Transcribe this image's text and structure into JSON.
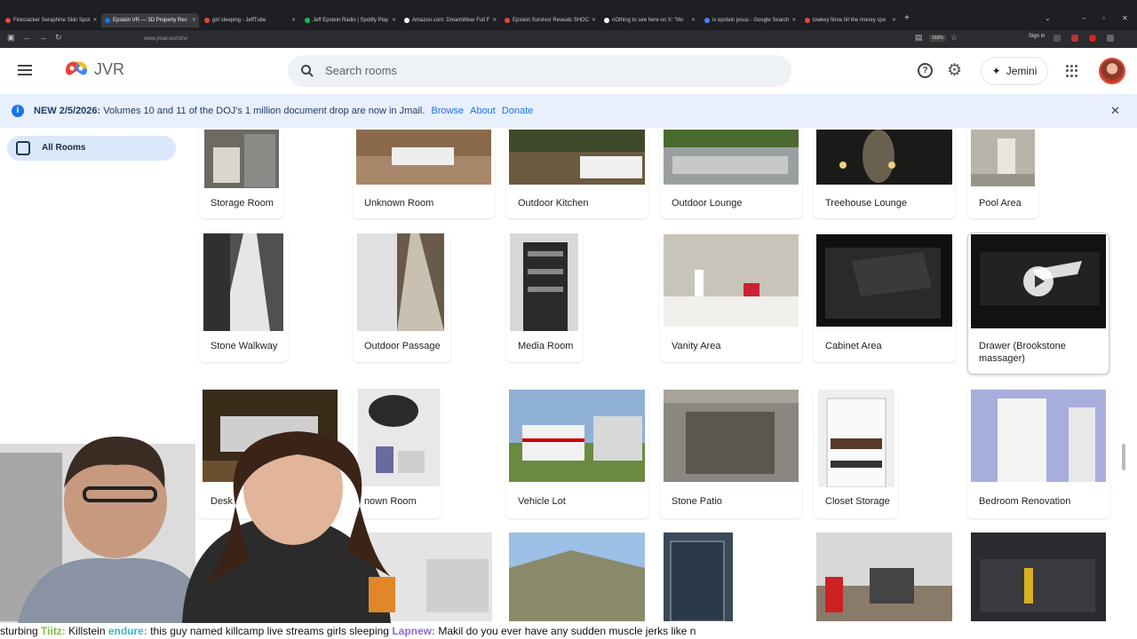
{
  "browser": {
    "tabs": [
      {
        "title": "Firecracker Seraphine Skin Spot",
        "color": "#e04b3b"
      },
      {
        "title": "Epstein VR — 3D Property Rec",
        "color": "#1a73e8"
      },
      {
        "title": "girl sleeping - JeffTube",
        "color": "#e04b3b"
      },
      {
        "title": "Jeff Epstein Radio | Spotify Play",
        "color": "#1db954"
      },
      {
        "title": "Amazon.com: DreamWear Full F",
        "color": "#ffffff"
      },
      {
        "title": "Epstein Survivor Reveals SHOC",
        "color": "#e04b3b"
      },
      {
        "title": "nOthing to see here on X: \"Mo",
        "color": "#ffffff"
      },
      {
        "title": "is epstein jesus - Google Search",
        "color": "#4285f4"
      },
      {
        "title": "lowkey finna hit the money spo",
        "color": "#e04b3b"
      }
    ],
    "url": "www.jmail.world/vr",
    "zoom": "160%",
    "signin": "Sign in"
  },
  "header": {
    "app_name": "JVR",
    "search_placeholder": "Search rooms",
    "assistant_label": "Jemini"
  },
  "banner": {
    "prefix": "NEW 2/5/2026:",
    "message": "Volumes 10 and 11 of the DOJ's 1 million document drop are now in Jmail.",
    "links": [
      "Browse",
      "About",
      "Donate"
    ]
  },
  "sidebar": {
    "items": [
      {
        "label": "All Rooms"
      }
    ]
  },
  "rooms": [
    {
      "label": "Storage Room"
    },
    {
      "label": "Unknown Room"
    },
    {
      "label": "Outdoor Kitchen"
    },
    {
      "label": "Outdoor Lounge"
    },
    {
      "label": "Treehouse Lounge"
    },
    {
      "label": "Pool Area"
    },
    {
      "label": "Stone Walkway"
    },
    {
      "label": "Outdoor Passage"
    },
    {
      "label": "Media Room"
    },
    {
      "label": "Vanity Area"
    },
    {
      "label": "Cabinet Area"
    },
    {
      "label": "Drawer (Brookstone massager)"
    },
    {
      "label": "Desk"
    },
    {
      "label": "nown Room"
    },
    {
      "label": "Vehicle Lot"
    },
    {
      "label": "Stone Patio"
    },
    {
      "label": "Closet Storage"
    },
    {
      "label": "Bedroom Renovation"
    }
  ],
  "chat": {
    "line": [
      {
        "text": "sturbing ",
        "color": "#111111",
        "bold": false
      },
      {
        "text": "Tiitz:",
        "color": "#7bc043",
        "bold": true
      },
      {
        "text": " Killstein ",
        "color": "#111111",
        "bold": false
      },
      {
        "text": "endure:",
        "color": "#3ab7c9",
        "bold": true
      },
      {
        "text": " this guy named killcamp live streams girls sleeping ",
        "color": "#111111",
        "bold": false
      },
      {
        "text": "Lapnew:",
        "color": "#8a6bd6",
        "bold": true
      },
      {
        "text": " Makil do you ever have any sudden muscle jerks like n",
        "color": "#111111",
        "bold": false
      }
    ]
  }
}
